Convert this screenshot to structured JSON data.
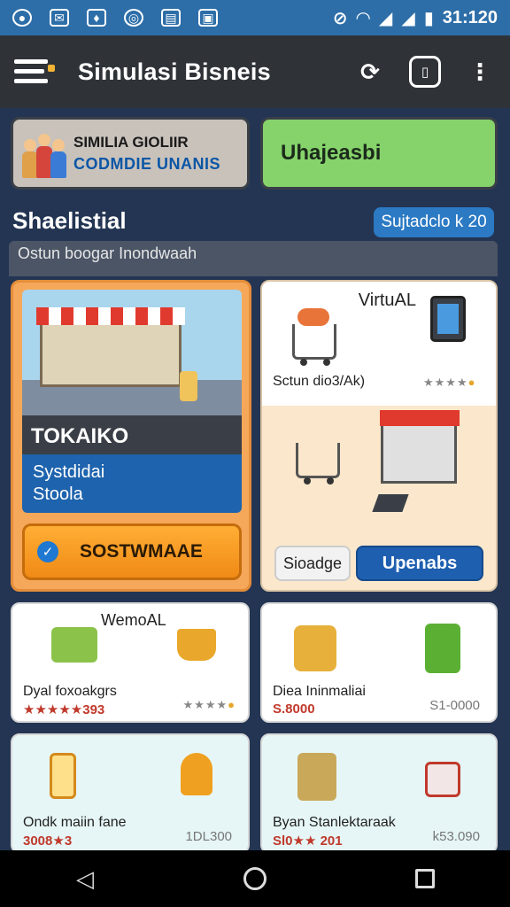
{
  "status_bar": {
    "time": "31:120",
    "icons": [
      "shield-icon",
      "mail-icon",
      "water-drop-icon",
      "target-icon",
      "keyboard-icon",
      "clipboard-icon",
      "no-sim-icon",
      "wifi-icon",
      "signal-icon",
      "battery-icon"
    ]
  },
  "app_bar": {
    "title": "Simulasi Bisneis",
    "actions": [
      "refresh-icon",
      "tablet-icon",
      "more-vert-icon"
    ]
  },
  "banners": {
    "left": {
      "line1": "SIMILIA GIOLIIR",
      "line2": "CODMDIE UNANIS"
    },
    "right": {
      "label": "Uhajeasbi"
    }
  },
  "section": {
    "title": "Shaelistial",
    "pill": "Sujtadclo k 20",
    "subtitle": "Ostun boogar Inondwaah"
  },
  "cards": {
    "featured": {
      "name": "TOKAIKO",
      "desc_line1": "Systdidai",
      "desc_line2": "Stoola",
      "cta": "SOSTWMAAE"
    },
    "virtual": {
      "label": "VirtuAL",
      "meta": "Sctun dio3/Ak)",
      "secondary_button": "Sioadge",
      "primary_button": "Upenabs"
    },
    "items": [
      {
        "title": "WemoAL",
        "name": "Dyal foxoakgrs",
        "sub": "★★★★★393",
        "val": ""
      },
      {
        "title": "",
        "name": "Diea Ininmaliai",
        "sub": "S.8000",
        "val": "S1-0000"
      },
      {
        "title": "",
        "name": "Ondk maiin fane",
        "sub": "3008★3",
        "val": "1DL300"
      },
      {
        "title": "",
        "name": "Byan Stanlektaraak",
        "sub": "Sl0★★ 201",
        "val": "k53.090"
      }
    ]
  },
  "colors": {
    "status_bar": "#2d6ea8",
    "app_bar": "#2f3338",
    "background": "#233553",
    "accent_orange": "#f5a85a",
    "accent_blue": "#1e63ad",
    "accent_green": "#86d36b"
  },
  "nav": [
    "back-icon",
    "home-icon",
    "recents-icon"
  ]
}
